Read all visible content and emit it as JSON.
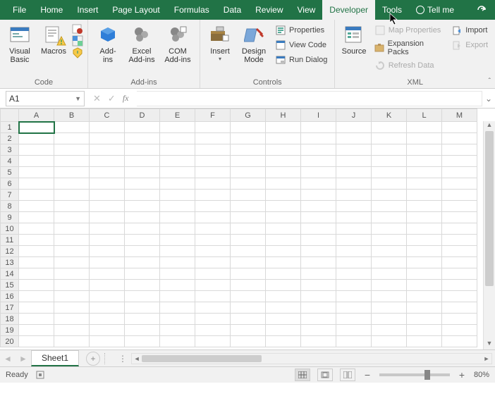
{
  "tabs": {
    "file": "File",
    "home": "Home",
    "insert": "Insert",
    "page_layout": "Page Layout",
    "formulas": "Formulas",
    "data": "Data",
    "review": "Review",
    "view": "View",
    "developer": "Developer",
    "tools": "Tools",
    "tell_me": "Tell me"
  },
  "ribbon": {
    "code": {
      "label": "Code",
      "visual_basic": "Visual\nBasic",
      "macros": "Macros"
    },
    "addins": {
      "label": "Add-ins",
      "addins": "Add-\nins",
      "excel_addins": "Excel\nAdd-ins",
      "com_addins": "COM\nAdd-ins"
    },
    "controls": {
      "label": "Controls",
      "insert": "Insert",
      "design_mode": "Design\nMode",
      "properties": "Properties",
      "view_code": "View Code",
      "run_dialog": "Run Dialog"
    },
    "xml": {
      "label": "XML",
      "source": "Source",
      "map_properties": "Map Properties",
      "expansion_packs": "Expansion Packs",
      "refresh_data": "Refresh Data",
      "import": "Import",
      "export": "Export"
    }
  },
  "namebox": {
    "value": "A1"
  },
  "fx": {
    "label": "fx"
  },
  "columns": [
    "A",
    "B",
    "C",
    "D",
    "E",
    "F",
    "G",
    "H",
    "I",
    "J",
    "K",
    "L",
    "M"
  ],
  "row_count": 20,
  "sheettab": {
    "name": "Sheet1"
  },
  "status": {
    "ready": "Ready",
    "zoom": "80%"
  }
}
